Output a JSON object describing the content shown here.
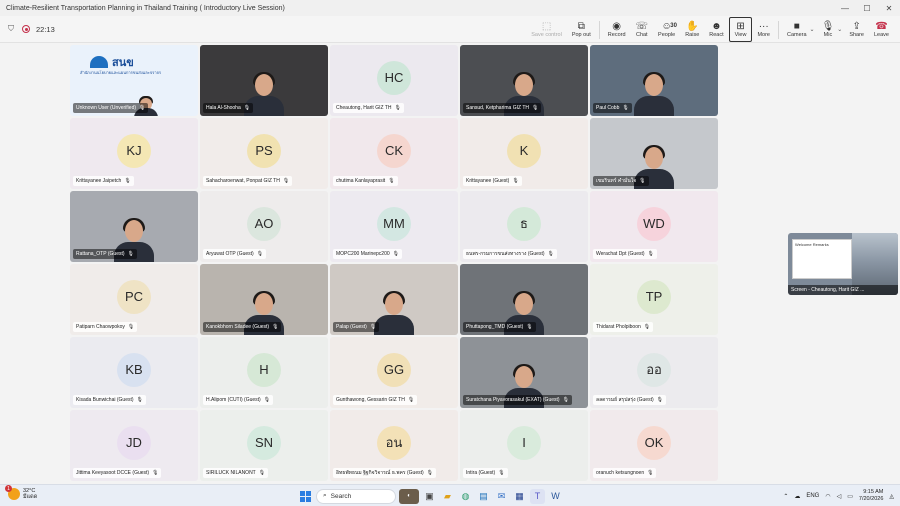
{
  "window": {
    "title": "Climate-Resilient Transportation Planning in Thailand Training ( Introductory Live Session)",
    "controls": [
      "—",
      "☐",
      "✕"
    ]
  },
  "toolbar": {
    "timer": "22:13",
    "buttons": [
      {
        "icon": "screen-share-icon",
        "glyph": "⬚",
        "label": "Save control",
        "dim": true
      },
      {
        "icon": "pop-out-icon",
        "glyph": "⧉",
        "label": "Pop out"
      },
      {
        "icon": "record-icon",
        "glyph": "◉",
        "label": "Record"
      },
      {
        "icon": "chat-icon",
        "glyph": "☏",
        "label": "Chat"
      },
      {
        "icon": "people-icon",
        "glyph": "☺",
        "label": "People",
        "count": "30"
      },
      {
        "icon": "raise-hand-icon",
        "glyph": "✋",
        "label": "Raise"
      },
      {
        "icon": "react-icon",
        "glyph": "☻",
        "label": "React"
      },
      {
        "icon": "view-icon",
        "glyph": "⊞",
        "label": "View",
        "active": true
      },
      {
        "icon": "more-icon",
        "glyph": "···",
        "label": "More"
      },
      {
        "icon": "camera-icon",
        "glyph": "■",
        "label": "Camera"
      },
      {
        "icon": "mic-icon",
        "glyph": "🎙",
        "label": "Mic"
      },
      {
        "icon": "share-icon",
        "glyph": "⇪",
        "label": "Share"
      },
      {
        "icon": "leave-icon",
        "glyph": "☎",
        "label": "Leave"
      }
    ]
  },
  "participants": [
    {
      "name": "Unknown User (Unverified)",
      "cam": "logo"
    },
    {
      "name": "Hala Al-Shooha",
      "cam": "person",
      "bg": "#3b3a3c"
    },
    {
      "name": "Cheautong, Harit GIZ TH",
      "initials": "HC",
      "avatar_color": "#cfe6da",
      "tile_color": "#ece9ef"
    },
    {
      "name": "Sansud, Ketpharima GIZ TH",
      "cam": "person",
      "bg": "#4c4e52"
    },
    {
      "name": "Paul Cobb",
      "cam": "person",
      "bg": "#5e6d7d"
    },
    {
      "name": "Krittayanee Jaipetch",
      "initials": "KJ",
      "avatar_color": "#f4e7b4",
      "tile_color": "#efe9ef"
    },
    {
      "name": "Sahacharoenwat, Ponpat GIZ TH",
      "initials": "PS",
      "avatar_color": "#f1e2b1",
      "tile_color": "#f1ecea"
    },
    {
      "name": "chutima Kanlayaprasit",
      "initials": "CK",
      "avatar_color": "#f5d6cf",
      "tile_color": "#f1e8ec"
    },
    {
      "name": "Krittayanee (Guest)",
      "initials": "K",
      "avatar_color": "#f1e1b3",
      "tile_color": "#f1ebe9"
    },
    {
      "name": "เขมรินทร์ คำมั่นใจ",
      "cam": "person",
      "bg": "#c5c8cc"
    },
    {
      "name": "Rattana_OTP (Guest)",
      "cam": "person",
      "bg": "#a7aab0"
    },
    {
      "name": "Aryuwat OTP (Guest)",
      "initials": "AO",
      "avatar_color": "#dbe6de",
      "tile_color": "#eeecec"
    },
    {
      "name": "MOPC200 Marinepc200",
      "initials": "MM",
      "avatar_color": "#d3e7e2",
      "tile_color": "#edeaf0"
    },
    {
      "name": "ธนพร-กรมการขนส่งทางราง (Guest)",
      "initials": "ธ",
      "avatar_color": "#d4e9d9",
      "tile_color": "#eceaee"
    },
    {
      "name": "Werachat Dpt (Guest)",
      "initials": "WD",
      "avatar_color": "#f6d3dc",
      "tile_color": "#f1e8ee"
    },
    {
      "name": "Patiparn Chaowpokoy",
      "initials": "PC",
      "avatar_color": "#efe3c5",
      "tile_color": "#f0ecea"
    },
    {
      "name": "Kanokbhorn Siladee (Guest)",
      "cam": "person",
      "bg": "#b9b4ae"
    },
    {
      "name": "Palap (Guest)",
      "cam": "person",
      "bg": "#cfc9c4"
    },
    {
      "name": "Phuttapong_TMD (Guest)",
      "cam": "person",
      "bg": "#6f7378"
    },
    {
      "name": "Thidarat Pholpiboon",
      "initials": "TP",
      "avatar_color": "#dde9cf",
      "tile_color": "#eef0ea"
    },
    {
      "name": "Kisada Bunwichai (Guest)",
      "initials": "KB",
      "avatar_color": "#d8e1f0",
      "tile_color": "#ebebf0"
    },
    {
      "name": "H.Alipom (CUTI) (Guest)",
      "initials": "H",
      "avatar_color": "#d6e8d6",
      "tile_color": "#eceeec"
    },
    {
      "name": "Gunthawong, Gessarin GIZ TH",
      "initials": "GG",
      "avatar_color": "#f1e0b7",
      "tile_color": "#f1ece9"
    },
    {
      "name": "Suratchana Piyavorasakul (EXAT) (Guest)",
      "cam": "person",
      "bg": "#8e9297"
    },
    {
      "name": "ลลดารมย์ สรุปสรุ่ง (Guest)",
      "initials": "ออ",
      "avatar_color": "#dfe7e6",
      "tile_color": "#ecebee"
    },
    {
      "name": "Jittima Keeyasoot DCCE (Guest)",
      "initials": "JD",
      "avatar_color": "#eadff0",
      "tile_color": "#eeeaf0"
    },
    {
      "name": "SIRILUCK NILANONT",
      "initials": "SN",
      "avatar_color": "#d5eadf",
      "tile_color": "#ecefec"
    },
    {
      "name": "อิทธพัทธนม ฐิฐกิจวิจารณ์ ธ.พคร (Guest)",
      "initials": "อน",
      "avatar_color": "#f3e1b7",
      "tile_color": "#f1ebe9"
    },
    {
      "name": "Intira (Guest)",
      "initials": "I",
      "avatar_color": "#d9ebdc",
      "tile_color": "#eceeec"
    },
    {
      "name": "oranuch ketsungnoen",
      "initials": "OK",
      "avatar_color": "#f6d9d0",
      "tile_color": "#f1eaec"
    }
  ],
  "screen_share": {
    "label": "Screen - Cheautong, Harit GIZ ...",
    "doc_title": "Welcome Remarks"
  },
  "logo_tile": {
    "text": "สนข",
    "subtext": "สำนักงานนโยบายและแผนการขนส่งและจราจร"
  },
  "taskbar": {
    "weather_temp": "32°C",
    "weather_desc": "มีแดด",
    "weather_badge": "1",
    "search_placeholder": "Search",
    "lang": "ENG",
    "time": "9:15 AM",
    "date": "7/20/2026"
  },
  "colors": {
    "leave": "#c4314b",
    "accent": "#2a7de1"
  }
}
